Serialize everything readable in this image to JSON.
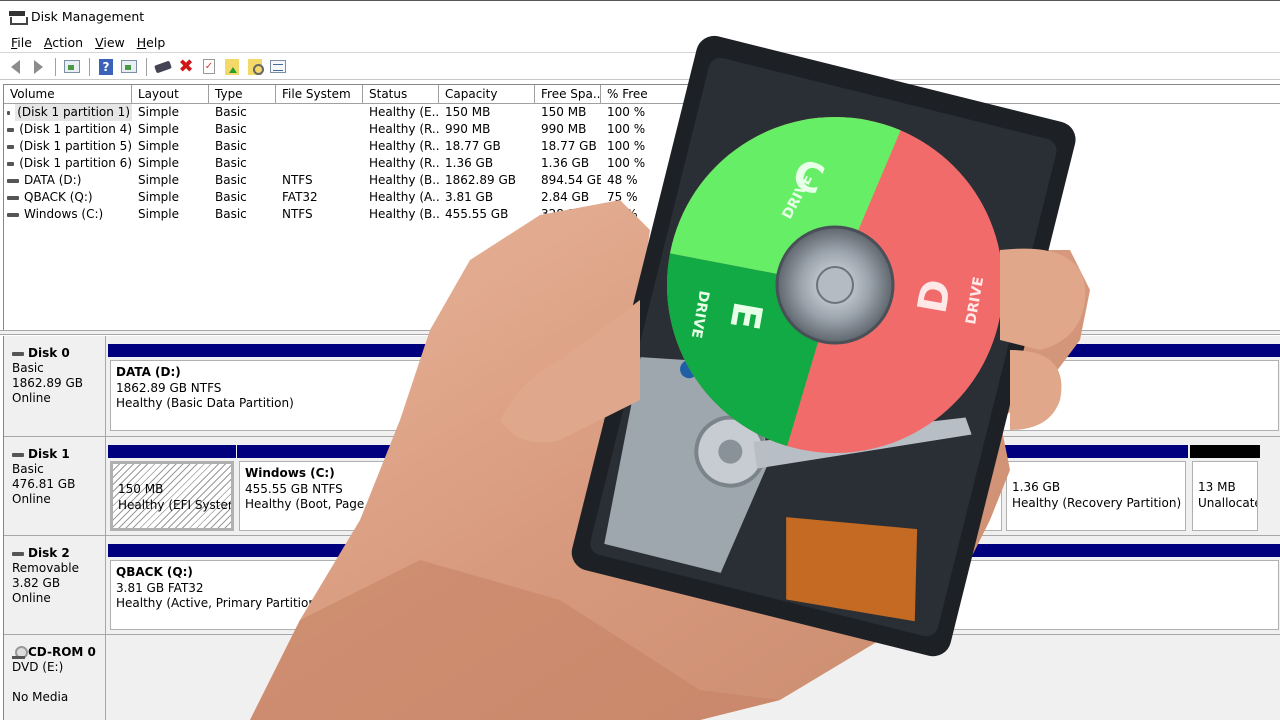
{
  "window": {
    "title": "Disk Management",
    "app_icon": "disk-management-icon"
  },
  "menu": [
    {
      "label": "File",
      "accel": "F",
      "rest": "ile"
    },
    {
      "label": "Action",
      "accel": "A",
      "rest": "ction"
    },
    {
      "label": "View",
      "accel": "V",
      "rest": "iew"
    },
    {
      "label": "Help",
      "accel": "H",
      "rest": "elp"
    }
  ],
  "toolbar": {
    "icons": [
      "back-arrow-icon",
      "forward-arrow-icon",
      "show-hide-console-tree-icon",
      "help-icon",
      "show-hide-action-pane-icon",
      "connect-virtual-disk-icon",
      "delete-icon",
      "properties-icon",
      "open-folder-icon",
      "explore-icon",
      "list-view-icon"
    ]
  },
  "volume_list": {
    "columns": [
      "Volume",
      "Layout",
      "Type",
      "File System",
      "Status",
      "Capacity",
      "Free Spa...",
      "% Free"
    ],
    "rows": [
      {
        "volume": "(Disk 1 partition 1)",
        "layout": "Simple",
        "type": "Basic",
        "fs": "",
        "status": "Healthy (E...",
        "capacity": "150 MB",
        "free": "150 MB",
        "pct": "100 %"
      },
      {
        "volume": "(Disk 1 partition 4)",
        "layout": "Simple",
        "type": "Basic",
        "fs": "",
        "status": "Healthy (R...",
        "capacity": "990 MB",
        "free": "990 MB",
        "pct": "100 %"
      },
      {
        "volume": "(Disk 1 partition 5)",
        "layout": "Simple",
        "type": "Basic",
        "fs": "",
        "status": "Healthy (R...",
        "capacity": "18.77 GB",
        "free": "18.77 GB",
        "pct": "100 %"
      },
      {
        "volume": "(Disk 1 partition 6)",
        "layout": "Simple",
        "type": "Basic",
        "fs": "",
        "status": "Healthy (R...",
        "capacity": "1.36 GB",
        "free": "1.36 GB",
        "pct": "100 %"
      },
      {
        "volume": "DATA (D:)",
        "layout": "Simple",
        "type": "Basic",
        "fs": "NTFS",
        "status": "Healthy (B...",
        "capacity": "1862.89 GB",
        "free": "894.54 GB",
        "pct": "48 %"
      },
      {
        "volume": "QBACK (Q:)",
        "layout": "Simple",
        "type": "Basic",
        "fs": "FAT32",
        "status": "Healthy (A...",
        "capacity": "3.81 GB",
        "free": "2.84 GB",
        "pct": "75 %"
      },
      {
        "volume": "Windows (C:)",
        "layout": "Simple",
        "type": "Basic",
        "fs": "NTFS",
        "status": "Healthy (B...",
        "capacity": "455.55 GB",
        "free": "328.26 GB",
        "pct": "72 %"
      }
    ]
  },
  "disks": [
    {
      "name": "Disk 0",
      "kind": "Basic",
      "size": "1862.89 GB",
      "state": "Online",
      "partitions": [
        {
          "title": "DATA  (D:)",
          "line1": "1862.89 GB NTFS",
          "line2": "Healthy (Basic Data Partition)"
        }
      ]
    },
    {
      "name": "Disk 1",
      "kind": "Basic",
      "size": "476.81 GB",
      "state": "Online",
      "partitions": [
        {
          "title": "",
          "line1": "150 MB",
          "line2": "Healthy (EFI System Partition)"
        },
        {
          "title": "Windows  (C:)",
          "line1": "455.55 GB NTFS",
          "line2": "Healthy (Boot, Page File, Crash Dump, Basic Data Partition)"
        },
        {
          "title": "",
          "line1": "1.36 GB",
          "line2": "Healthy (Recovery Partition)"
        },
        {
          "title": "",
          "line1": "13 MB",
          "line2": "Unallocated"
        }
      ]
    },
    {
      "name": "Disk 2",
      "kind": "Removable",
      "size": "3.82 GB",
      "state": "Online",
      "partitions": [
        {
          "title": "QBACK  (Q:)",
          "line1": "3.81 GB FAT32",
          "line2": "Healthy (Active, Primary Partition)"
        }
      ]
    },
    {
      "name": "CD-ROM 0",
      "kind": "DVD (E:)",
      "size": "",
      "state": "No Media",
      "partitions": []
    }
  ],
  "overlay": {
    "description": "hand holding opened hard drive",
    "platter_labels": [
      {
        "letter": "C",
        "word": "DRIVE",
        "color": "#66ee66"
      },
      {
        "letter": "D",
        "word": "DRIVE",
        "color": "#f26b6b"
      },
      {
        "letter": "E",
        "word": "DRIVE",
        "color": "#11aa44"
      }
    ]
  },
  "colors": {
    "primary_partition_bar": "#00007f",
    "unallocated_bar": "#000000"
  }
}
